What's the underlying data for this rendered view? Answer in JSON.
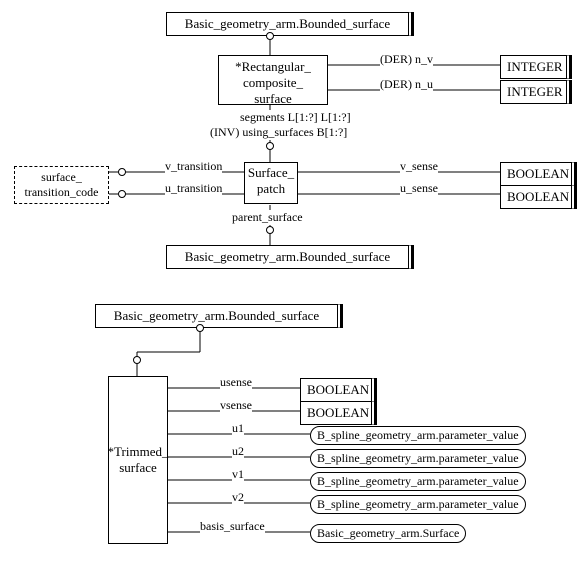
{
  "chart_data": {
    "type": "diagram",
    "top": {
      "super": "Basic_geometry_arm.Bounded_surface",
      "rect_comp": "*Rectangular_\ncomposite_\nsurface",
      "der_nv_lbl": "(DER) n_v",
      "der_nu_lbl": "(DER) n_u",
      "int1": "INTEGER",
      "int2": "INTEGER",
      "segments_lbl": "segments L[1:?] L[1:?]",
      "inv_lbl": "(INV) using_surfaces B[1:?]",
      "surface_patch": "Surface_\npatch",
      "vtrans": "v_transition",
      "utrans": "u_transition",
      "vsense": "v_sense",
      "usense": "u_sense",
      "bool1": "BOOLEAN",
      "bool2": "BOOLEAN",
      "stc": "surface_\ntransition_code",
      "parent_lbl": "parent_surface",
      "parent_box": "Basic_geometry_arm.Bounded_surface"
    },
    "bottom": {
      "super": "Basic_geometry_arm.Bounded_surface",
      "trimmed": "*Trimmed_\nsurface",
      "usense_lbl": "usense",
      "vsense_lbl": "vsense",
      "u1_lbl": "u1",
      "u2_lbl": "u2",
      "v1_lbl": "v1",
      "v2_lbl": "v2",
      "basis_lbl": "basis_surface",
      "bool1": "BOOLEAN",
      "bool2": "BOOLEAN",
      "pv": "B_spline_geometry_arm.parameter_value",
      "bsurf": "Basic_geometry_arm.Surface"
    }
  }
}
